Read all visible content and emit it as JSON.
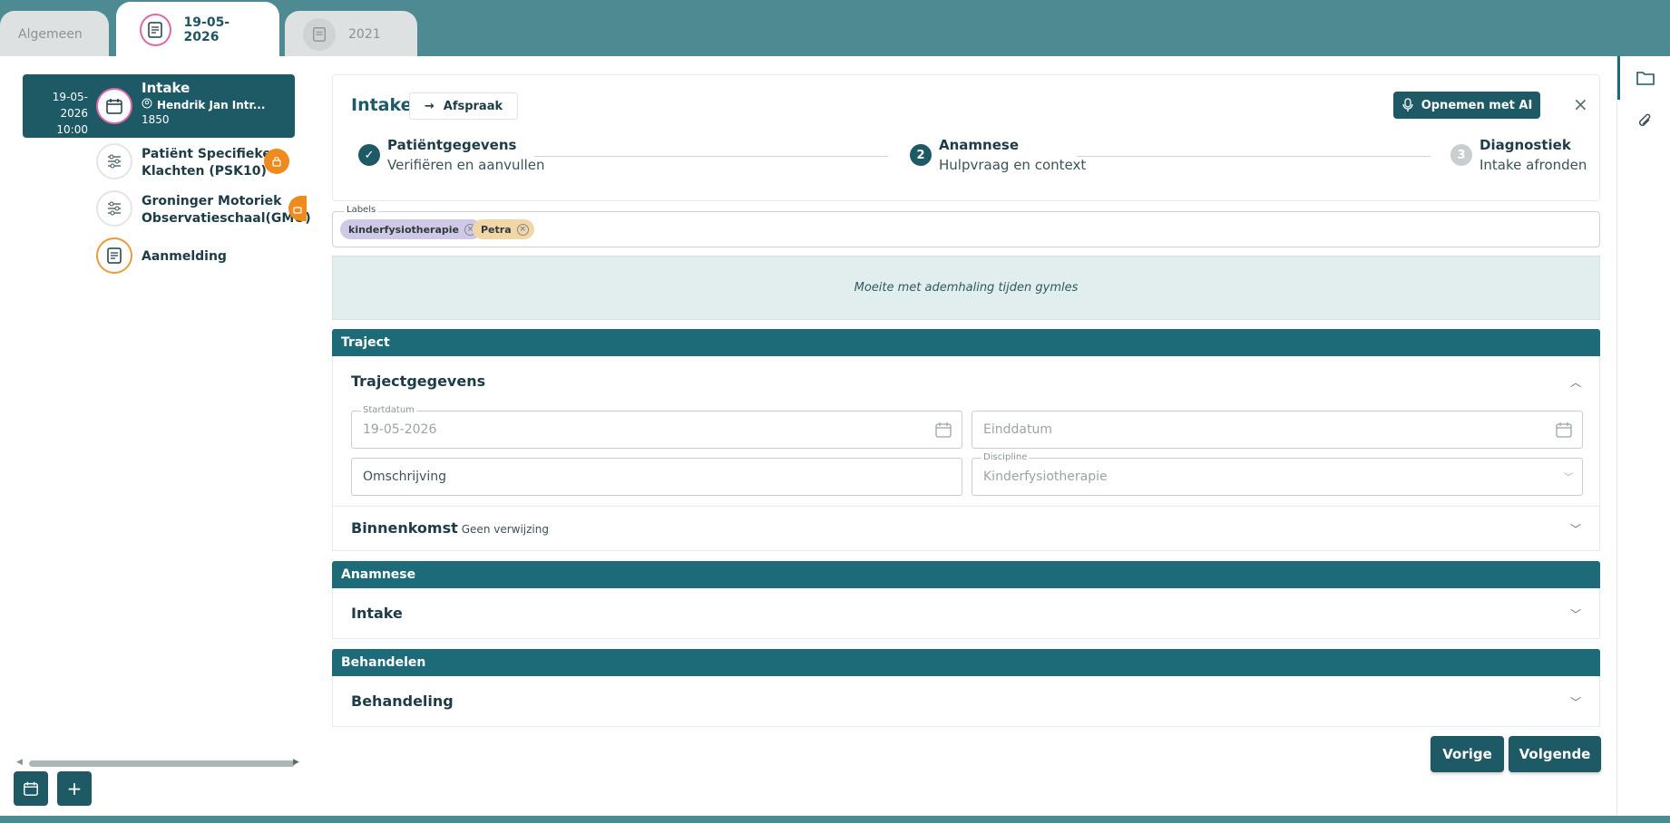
{
  "tabs": [
    {
      "label": "Algemeen"
    },
    {
      "label": "19-05-2026"
    },
    {
      "label": "2021"
    }
  ],
  "sidebar": {
    "active": {
      "date": "19-05-2026",
      "time": "10:00",
      "title": "Intake",
      "patient": "Hendrik Jan Intr...",
      "number": "1850"
    },
    "items": [
      {
        "label": "Patiënt Specifieke Klachten (PSK10)",
        "locked": true
      },
      {
        "label": "Groninger Motoriek Observatieschaal(GMO)",
        "locked": true
      },
      {
        "label": "Aanmelding",
        "locked": false
      }
    ]
  },
  "header": {
    "title": "Intake",
    "afspraak_label": "Afspraak",
    "ai_label": "Opnemen met AI",
    "close_label": "×"
  },
  "steps": [
    {
      "number": "✓",
      "title": "Patiëntgegevens",
      "subtitle": "Verifiëren en aanvullen",
      "state": "done"
    },
    {
      "number": "2",
      "title": "Anamnese",
      "subtitle": "Hulpvraag en context",
      "state": "active"
    },
    {
      "number": "3",
      "title": "Diagnostiek",
      "subtitle": "Intake afronden",
      "state": "todo"
    }
  ],
  "labels": {
    "caption": "Labels",
    "chips": [
      {
        "label": "kinderfysiotherapie",
        "color": "#cfc8e6"
      },
      {
        "label": "Petra",
        "color": "#f3d6a8"
      }
    ]
  },
  "note": "Moeite met ademhaling tijden gymles",
  "traject": {
    "header": "Traject",
    "group_title": "Trajectgegevens",
    "startdatum_caption": "Startdatum",
    "startdatum_value": "19-05-2026",
    "einddatum_placeholder": "Einddatum",
    "omschrijving_placeholder": "Omschrijving",
    "discipline_caption": "Discipline",
    "discipline_value": "Kinderfysiotherapie",
    "binnenkomst_title": "Binnenkomst",
    "binnenkomst_sub": "Geen verwijzing"
  },
  "anamnese": {
    "header": "Anamnese",
    "row_title": "Intake"
  },
  "behandelen": {
    "header": "Behandelen",
    "row_title": "Behandeling"
  },
  "nav": {
    "prev_label": "Vorige",
    "next_label": "Volgende"
  },
  "colors": {
    "brand": "#1d5a66",
    "section": "#1d6a78",
    "lock": "#ee8a1e",
    "pink_ring": "#d96aa7"
  }
}
